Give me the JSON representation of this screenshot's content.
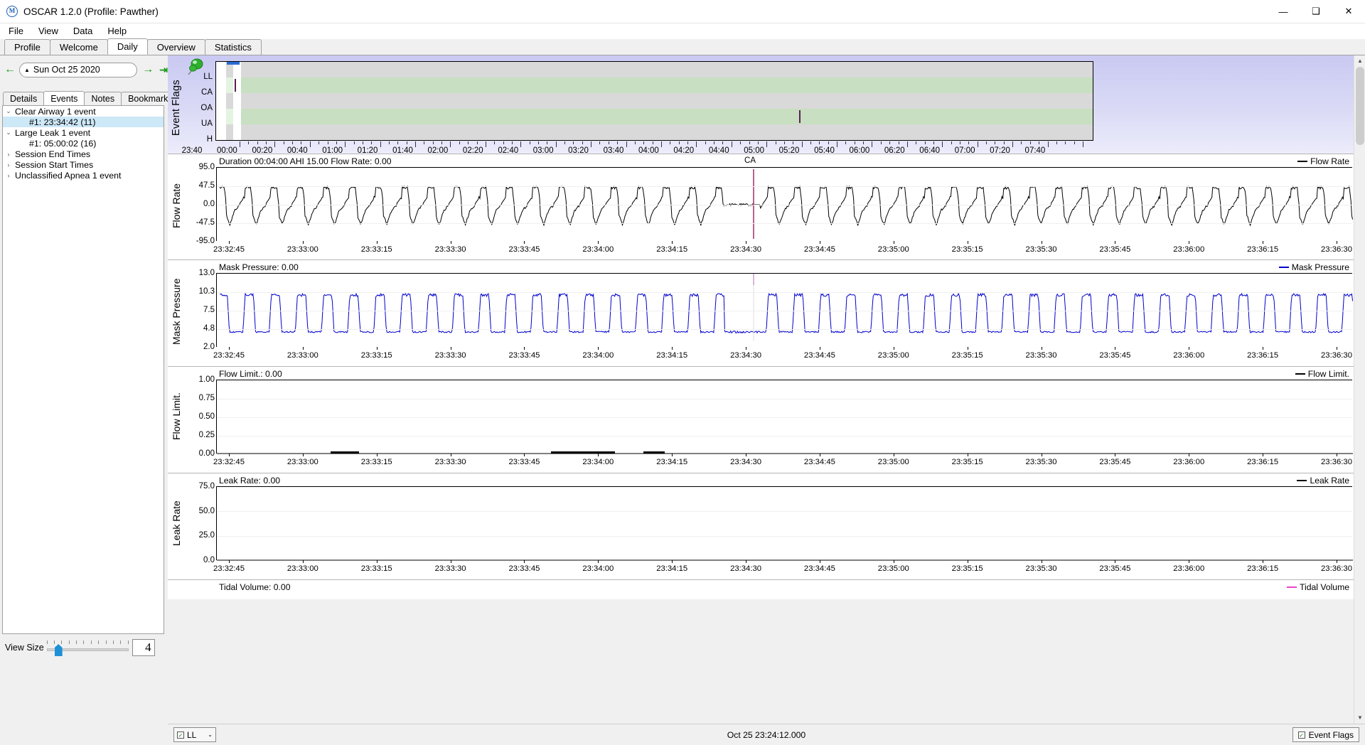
{
  "window": {
    "title": "OSCAR 1.2.0 (Profile: Pawther)",
    "icon": "oscar-logo-icon",
    "minimize": "—",
    "maximize": "❑",
    "close": "✕"
  },
  "menubar": {
    "items": [
      "File",
      "View",
      "Data",
      "Help"
    ]
  },
  "main_tabs": [
    {
      "label": "Profile",
      "active": false
    },
    {
      "label": "Welcome",
      "active": false
    },
    {
      "label": "Daily",
      "active": true
    },
    {
      "label": "Overview",
      "active": false
    },
    {
      "label": "Statistics",
      "active": false
    }
  ],
  "datebar": {
    "prev_icon": "←",
    "caret_icon": "▲",
    "date": "Sun Oct 25 2020",
    "next_icon": "→",
    "last_icon": "⇥"
  },
  "sub_tabs": [
    {
      "label": "Details",
      "active": false
    },
    {
      "label": "Events",
      "active": true
    },
    {
      "label": "Notes",
      "active": false
    },
    {
      "label": "Bookmarks",
      "active": false
    }
  ],
  "event_tree": [
    {
      "twisty": "⌄",
      "label": "Clear Airway 1 event",
      "child": false,
      "selected": false
    },
    {
      "twisty": "",
      "label": "#1: 23:34:42 (11)",
      "child": true,
      "selected": true
    },
    {
      "twisty": "⌄",
      "label": "Large Leak 1 event",
      "child": false,
      "selected": false
    },
    {
      "twisty": "",
      "label": "#1: 05:00:02 (16)",
      "child": true,
      "selected": false
    },
    {
      "twisty": "›",
      "label": "Session End Times",
      "child": false,
      "selected": false
    },
    {
      "twisty": "›",
      "label": "Session Start Times",
      "child": false,
      "selected": false
    },
    {
      "twisty": "›",
      "label": "Unclassified Apnea 1 event",
      "child": false,
      "selected": false
    }
  ],
  "view_size": {
    "label": "View Size",
    "value": "4"
  },
  "event_flags": {
    "axis_label": "Event Flags",
    "channels": [
      "LL",
      "CA",
      "OA",
      "UA",
      "H"
    ],
    "pin_icon": "pushpin-icon",
    "time_ticks": [
      "23:40",
      "00:00",
      "00:20",
      "00:40",
      "01:00",
      "01:20",
      "01:40",
      "02:00",
      "02:20",
      "02:40",
      "03:00",
      "03:20",
      "03:40",
      "04:00",
      "04:20",
      "04:40",
      "05:00",
      "05:20",
      "05:40",
      "06:00",
      "06:20",
      "06:40",
      "07:00",
      "07:20",
      "07:40"
    ],
    "markers": [
      {
        "channel": "CA",
        "position_pct": 2.1
      },
      {
        "channel": "UA",
        "position_pct": 66.4
      }
    ]
  },
  "graphs": [
    {
      "id": "flow-rate",
      "axis_label": "Flow Rate",
      "title": "Duration 00:04:00 AHI 15.00 Flow Rate: 0.00",
      "legend": "Flow Rate",
      "legend_color": "#000000",
      "y_ticks": [
        "95.0",
        "47.5",
        "0.0",
        "-47.5",
        "-95.0"
      ],
      "annotation": "CA"
    },
    {
      "id": "mask-pressure",
      "axis_label": "Mask Pressure",
      "title": "Mask Pressure: 0.00",
      "legend": "Mask Pressure",
      "legend_color": "#0000cc",
      "y_ticks": [
        "13.0",
        "10.3",
        "7.5",
        "4.8",
        "2.0"
      ],
      "annotation": ""
    },
    {
      "id": "flow-limit",
      "axis_label": "Flow Limit.",
      "title": "Flow Limit.: 0.00",
      "legend": "Flow Limit.",
      "legend_color": "#000000",
      "y_ticks": [
        "1.00",
        "0.75",
        "0.50",
        "0.25",
        "0.00"
      ],
      "annotation": ""
    },
    {
      "id": "leak-rate",
      "axis_label": "Leak Rate",
      "title": "Leak Rate: 0.00",
      "legend": "Leak Rate",
      "legend_color": "#000000",
      "y_ticks": [
        "75.0",
        "50.0",
        "25.0",
        "0.0"
      ],
      "annotation": ""
    }
  ],
  "graph_x_ticks": [
    "23:32:45",
    "23:33:00",
    "23:33:15",
    "23:33:30",
    "23:33:45",
    "23:34:00",
    "23:34:15",
    "23:34:30",
    "23:34:45",
    "23:35:00",
    "23:35:15",
    "23:35:30",
    "23:35:45",
    "23:36:00",
    "23:36:15",
    "23:36:30"
  ],
  "tidal_volume": {
    "title": "Tidal Volume: 0.00",
    "legend": "Tidal Volume",
    "legend_color": "#ee44cc"
  },
  "statusbar": {
    "combo_label": "LL",
    "combo_check": "✓",
    "combo_caret": "⌄",
    "center_text": "Oct 25 23:24:12.000",
    "right_label": "Event Flags",
    "right_check": "✓"
  },
  "chart_data": {
    "type": "line",
    "title": "Duration 00:04:00 AHI 15.00 Flow Rate: 0.00",
    "xlabel": "",
    "ylabel": "Flow Rate",
    "x_range": [
      "23:32:45",
      "23:36:35"
    ],
    "series": [
      {
        "name": "Flow Rate",
        "color": "#000000",
        "ylim": [
          -95.0,
          95.0
        ],
        "approx_peak": 25,
        "approx_trough": -30,
        "breath_period_s": 4.3
      },
      {
        "name": "Mask Pressure",
        "color": "#0000cc",
        "ylim": [
          2.0,
          13.0
        ],
        "approx_peak": 8.6,
        "approx_trough": 4.9
      },
      {
        "name": "Flow Limit.",
        "color": "#000000",
        "ylim": [
          0.0,
          1.0
        ],
        "approx_peak": 0.0
      },
      {
        "name": "Leak Rate",
        "color": "#000000",
        "ylim": [
          0.0,
          75.0
        ],
        "approx_peak": 0.0
      }
    ],
    "annotations": [
      {
        "text": "CA",
        "x": "23:34:42"
      }
    ],
    "grid": true,
    "legend_position": "top-right"
  }
}
